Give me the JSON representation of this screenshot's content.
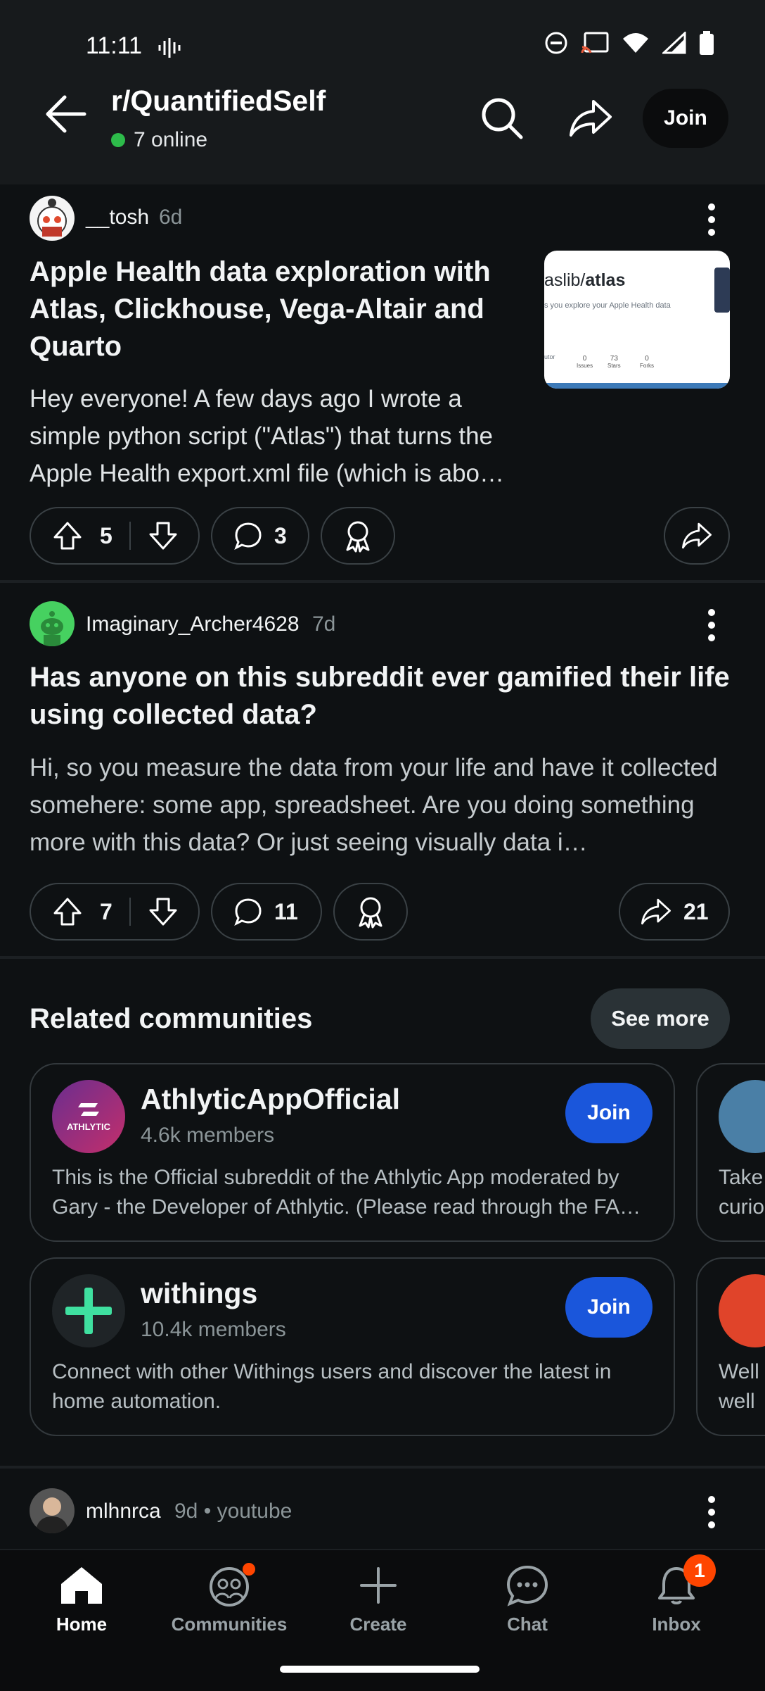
{
  "status_bar": {
    "time": "11:11"
  },
  "header": {
    "subreddit": "r/QuantifiedSelf",
    "online": "7 online",
    "join_label": "Join"
  },
  "posts": [
    {
      "author": "__tosh",
      "age": "6d",
      "title": "Apple Health data exploration with Atlas, Clickhouse, Vega-Altair and Quarto",
      "body": "Hey everyone! A few days ago I wrote a simple python script (\"Atlas\") that turns the Apple Health export.xml file (which is abo…",
      "score": "5",
      "comments": "3",
      "share_count": "",
      "thumbnail": {
        "repo": "aslib/atlas",
        "repo_prefix": "aslib/",
        "repo_name": "atlas",
        "tagline": "s you explore your Apple Health data",
        "stats": [
          "0",
          "73",
          "0"
        ],
        "stat_labels": [
          "Issues",
          "Stars",
          "Forks"
        ],
        "stat_prefix": "utor"
      }
    },
    {
      "author": "Imaginary_Archer4628",
      "age": "7d",
      "title": "Has anyone on this subreddit ever gamified their life using collected data?",
      "body": "Hi, so you measure the data from your life and have it collected somehere: some app, spreadsheet. Are you doing something more with this data? Or just seeing visually data i…",
      "score": "7",
      "comments": "11",
      "share_count": "21"
    }
  ],
  "related": {
    "title": "Related communities",
    "see_more": "See more",
    "communities": [
      {
        "name": "AthlyticAppOfficial",
        "members": "4.6k members",
        "description": "This is the Official subreddit of the Athlytic App moderated by Gary - the Developer of Athlytic.  (Please read through the FA…",
        "join": "Join",
        "logo_text": "ATHLYTIC",
        "color": "#9a2d7e"
      },
      {
        "name": "withings",
        "members": "10.4k members",
        "description": "Connect with other Withings users and discover the latest in home automation.",
        "join": "Join",
        "color": "#3fe0a0"
      }
    ],
    "peek_lines": [
      [
        "Take",
        "curio"
      ],
      [
        "Well",
        "well"
      ]
    ]
  },
  "next_post": {
    "author": "mlhnrca",
    "age": "9d",
    "source": "youtube"
  },
  "bottom_nav": [
    {
      "label": "Home",
      "icon": "home-icon",
      "active": true
    },
    {
      "label": "Communities",
      "icon": "communities-icon",
      "active": false
    },
    {
      "label": "Create",
      "icon": "plus-icon",
      "active": false
    },
    {
      "label": "Chat",
      "icon": "chat-icon",
      "active": false
    },
    {
      "label": "Inbox",
      "icon": "bell-icon",
      "active": false,
      "badge": "1"
    }
  ]
}
